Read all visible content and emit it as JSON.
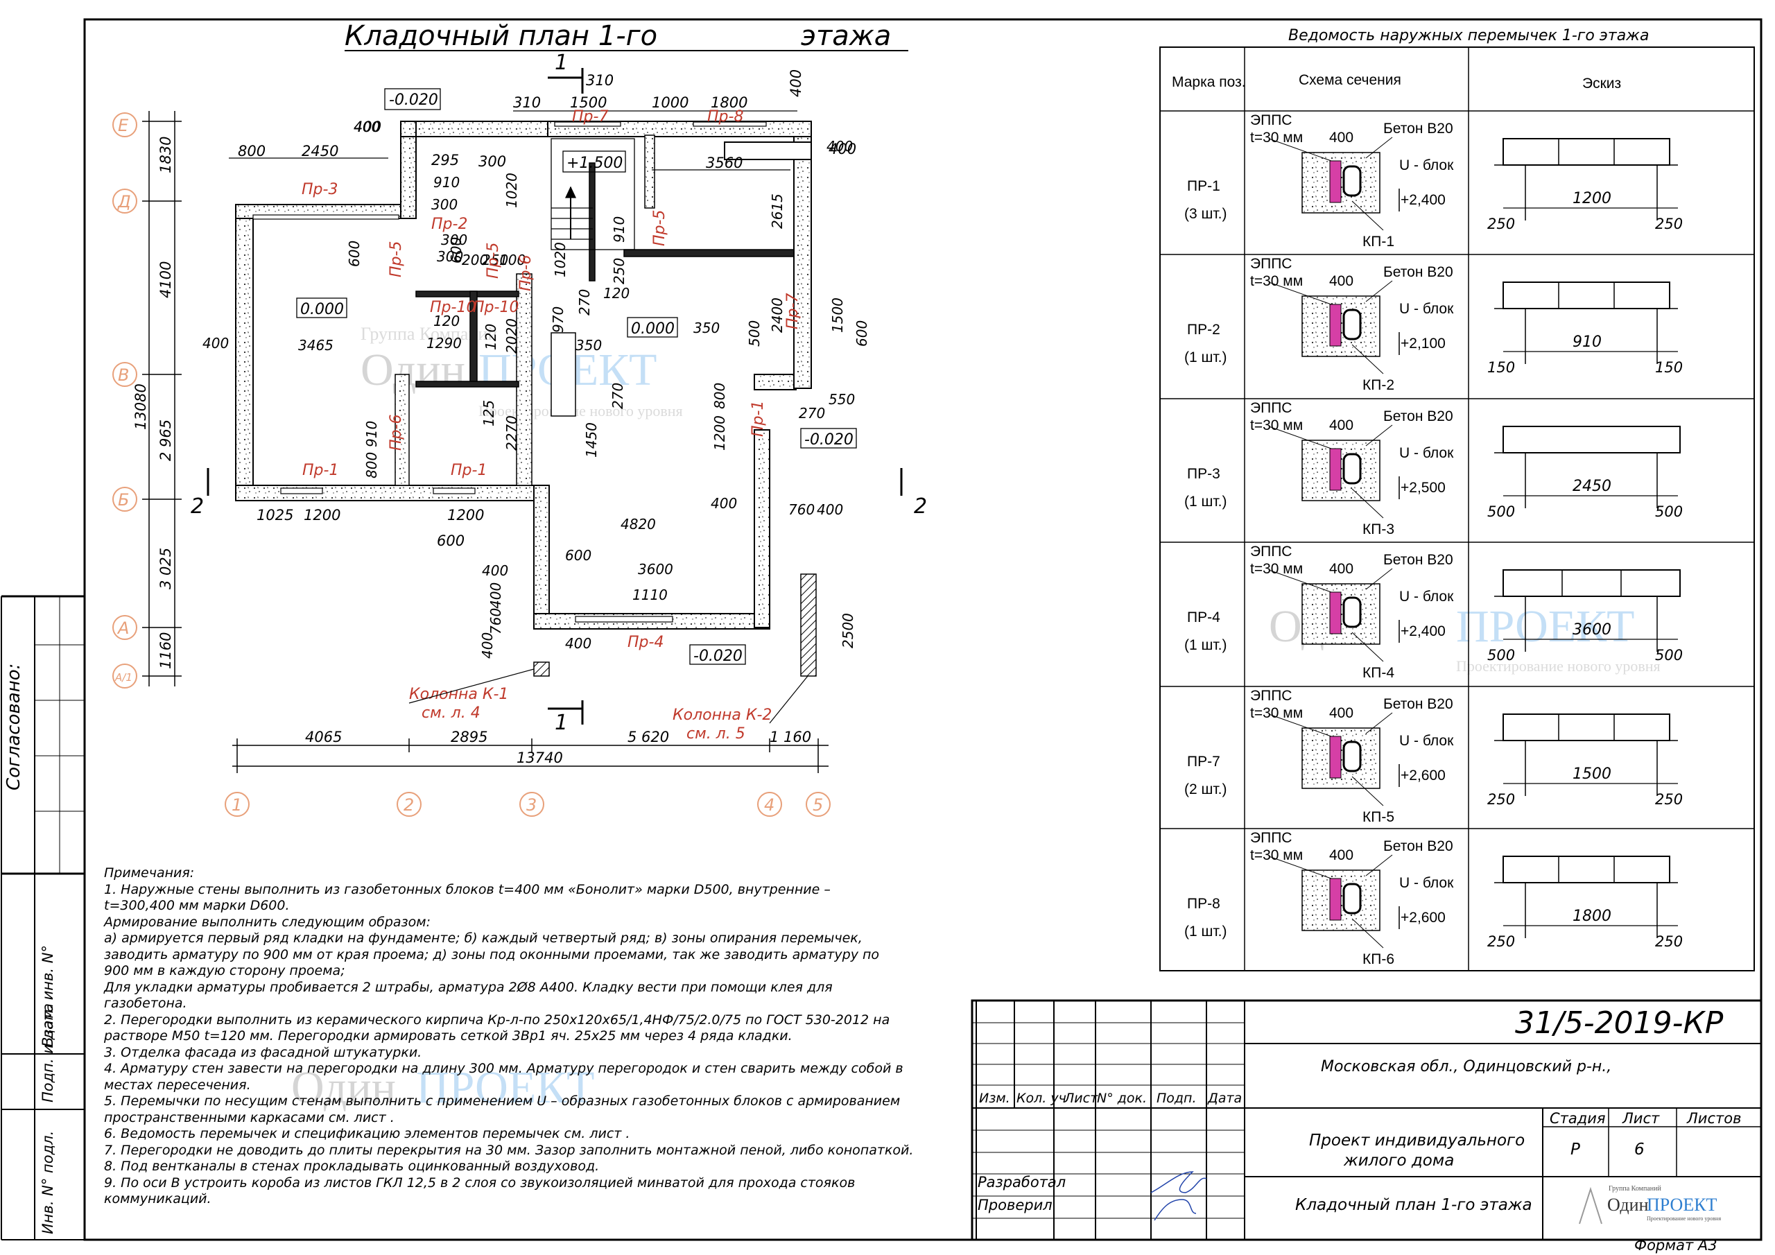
{
  "plan": {
    "title": "Кладочный план 1-го",
    "title_b": "этажа",
    "axes_rows": [
      "Е",
      "Д",
      "В",
      "Б",
      "А",
      "А/1"
    ],
    "axes_cols": [
      "1",
      "2",
      "3",
      "4",
      "5"
    ],
    "section_marks": [
      "1",
      "1",
      "2",
      "2"
    ],
    "elev": {
      "a": "-0.020",
      "b": "+1.500",
      "c": "0.000",
      "d": "0.000",
      "e": "-0.020",
      "f": "-0.020"
    },
    "dims_top": [
      "310",
      "310",
      "1500",
      "1000",
      "1800",
      "400",
      "400",
      "800",
      "2450",
      "295",
      "300",
      "3560",
      "400"
    ],
    "dims_left": [
      "1830",
      "4100",
      "13080",
      "2 965",
      "3 025",
      "1160"
    ],
    "dims_bottom": [
      "4065",
      "2895",
      "13740",
      "5 620",
      "1 160",
      "1025",
      "1200",
      "1200",
      "600"
    ],
    "dims_misc": [
      "910",
      "300",
      "300",
      "300",
      "120",
      "2615",
      "910",
      "1020",
      "970",
      "250",
      "270",
      "120",
      "2400",
      "1500",
      "600",
      "350",
      "500",
      "1290",
      "2020",
      "120",
      "350",
      "270",
      "1450",
      "2270",
      "125",
      "800",
      "1200",
      "270",
      "550",
      "400",
      "400",
      "3465",
      "600",
      "910",
      "800",
      "600",
      "1020",
      "200",
      "250",
      "100",
      "4820",
      "400",
      "760",
      "400",
      "600",
      "3600",
      "1110",
      "400",
      "400",
      "760",
      "400",
      "400",
      "2500",
      "400"
    ],
    "lintels": [
      "Пр-7",
      "Пр-8",
      "Пр-3",
      "Пр-2",
      "Пр-6",
      "Пр-5",
      "Пр-10",
      "Пр-10",
      "Пр-5",
      "Пр-7",
      "Пр-1",
      "Пр-1",
      "Пр-1",
      "Пр-4",
      "Пр-6",
      "Пр-5"
    ],
    "column1": "Колонна К-1",
    "column1_ref": "см. л. 4",
    "column2": "Колонна К-2",
    "column2_ref": "см. л. 5"
  },
  "watermark": {
    "brand_a": "Один",
    "brand_b": "ПРОЕКТ",
    "small": "Группа Компаний",
    "tag": "Проектирование нового уровня"
  },
  "schedule": {
    "title": "Ведомость наружных перемычек 1-го этажа",
    "headers": [
      "Марка поз.",
      "Схема сечения",
      "Эскиз"
    ],
    "section_labels": {
      "eps": "ЭППС",
      "t": "t=30 мм",
      "concrete": "Бетон В20",
      "ublock": "U - блок",
      "width": "400"
    },
    "rows": [
      {
        "mark": "ПР-1",
        "qty": "(3 шт.)",
        "level": "+2,400",
        "kp": "КП-1",
        "span": "1200",
        "left": "250",
        "right": "250"
      },
      {
        "mark": "ПР-2",
        "qty": "(1 шт.)",
        "level": "+2,100",
        "kp": "КП-2",
        "span": "910",
        "left": "150",
        "right": "150"
      },
      {
        "mark": "ПР-3",
        "qty": "(1 шт.)",
        "level": "+2,500",
        "kp": "КП-3",
        "span": "2450",
        "left": "500",
        "right": "500"
      },
      {
        "mark": "ПР-4",
        "qty": "(1 шт.)",
        "level": "+2,400",
        "kp": "КП-4",
        "span": "3600",
        "left": "500",
        "right": "500"
      },
      {
        "mark": "ПР-7",
        "qty": "(2 шт.)",
        "level": "+2,600",
        "kp": "КП-5",
        "span": "1500",
        "left": "250",
        "right": "250"
      },
      {
        "mark": "ПР-8",
        "qty": "(1 шт.)",
        "level": "+2,600",
        "kp": "КП-6",
        "span": "1800",
        "left": "250",
        "right": "250"
      }
    ]
  },
  "notes": {
    "heading": "Примечания:",
    "lines": [
      "1.  Наружные  стены  выполнить  из  газобетонных  блоков  t=400  мм  «Бонолит»  марки  D500,  внутренние  –",
      "t=300,400  мм   марки  D600.",
      "Армирование выполнить следующим образом:",
      "а)  армируется  первый  ряд  кладки  на  фундаменте;  б)  каждый  четвертый  ряд;  в)  зоны  опирания  перемычек,",
      "заводить  арматуру  по  900  мм  от  края  проема;  д)  зоны  под  оконными  проемами,  так  же  заводить  арматуру  по",
      "900 мм в каждую сторону проема;",
      "Для  укладки  арматуры  пробивается  2  штрабы,  арматура  2Ø8  А400.  Кладку  вести  при  помощи  клея  для",
      "газобетона.",
      "2.  Перегородки  выполнить  из  керамического  кирпича  Кр-л-по  250x120x65/1,4НФ/75/2.0/75  по  ГОСТ  530-2012  на",
      "растворе  М50  t=120  мм.  Перегородки  армировать  сеткой  3Вр1  яч.  25х25  мм  через  4  ряда  кладки.",
      "3.  Отделка  фасада  из  фасадной  штукатурки.",
      "4.  Арматуру  стен  завести  на  перегородки  на  длину  300  мм.  Арматуру  перегородок  и  стен  сварить  между  собой  в",
      "местах  пересечения.",
      "5.  Перемычки  по  несущим  стенам  выполнить  с  применением  U  –  образных  газобетонных  блоков  с  армированием",
      "пространственными  каркасами  см.  лист  .",
      "6.  Ведомость  перемычек  и    спецификацию  элементов  перемычек  см.  лист  .",
      "7.  Перегородки  не  доводить  до  плиты  перекрытия  на  30  мм.  Зазор  заполнить  монтажной  пеной,  либо  конопаткой.",
      "8.  Под  вентканалы  в  стенах   прокладывать  оцинкованный  воздуховод.",
      "9.  По  оси  В  устроить  короба  из  листов  ГКЛ  12,5  в  2  слоя  со  звукоизоляцией  минватой  для  прохода  стояков",
      "коммуникаций."
    ]
  },
  "stamp": {
    "code": "31/5-2019-КР",
    "location": "Московская обл.,  Одинцовский р-н.,",
    "cols": [
      "Изм.",
      "Кол. уч",
      "Лист",
      "N° док.",
      "Подп.",
      "Дата"
    ],
    "developed": "Разработал",
    "checked": "Проверил",
    "project_a": "Проект индивидуального",
    "project_b": "жилого дома",
    "sheet_title": "Кладочный план 1-го этажа",
    "stage_label": "Стадия",
    "sheet_label": "Лист",
    "sheets_label": "Листов",
    "stage": "Р",
    "sheet": "6",
    "logo_small": "Группа Компаний",
    "logo_a": "Один",
    "logo_b": "ПРОЕКТ",
    "logo_tag": "Проектирование нового уровня",
    "format": "Формат А3"
  },
  "side": {
    "agreed": "Согласовано:",
    "inv_vzam": "Взам. инв. N°",
    "sign_date": "Подп. и дата",
    "inv_podl": "Инв. N° подл."
  },
  "colors": {
    "ink": "#000000",
    "lintel_red": "#c0392b",
    "axis_orange": "#e8a07a",
    "ins_pink": "#d63fa6",
    "watermark": "#5aa6e8"
  }
}
